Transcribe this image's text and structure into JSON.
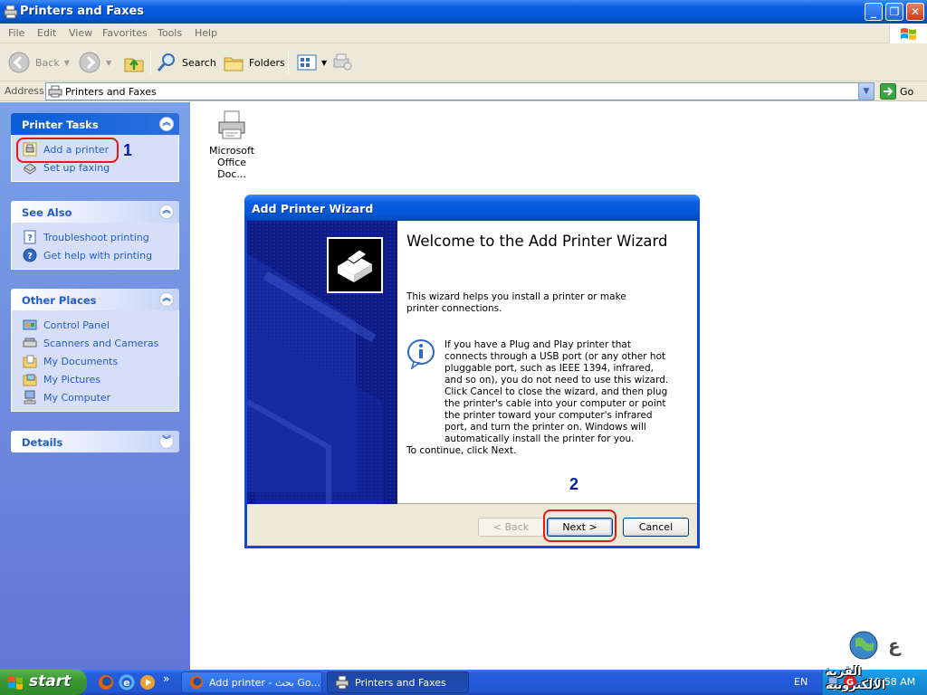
{
  "window": {
    "title": "Printers and Faxes"
  },
  "menu": [
    "File",
    "Edit",
    "View",
    "Favorites",
    "Tools",
    "Help"
  ],
  "toolbar": {
    "back": "Back",
    "search": "Search",
    "folders": "Folders"
  },
  "address": {
    "label": "Address",
    "value": "Printers and Faxes",
    "go": "Go"
  },
  "panels": {
    "printer_tasks": {
      "title": "Printer Tasks",
      "items": [
        "Add a printer",
        "Set up faxing"
      ]
    },
    "see_also": {
      "title": "See Also",
      "items": [
        "Troubleshoot printing",
        "Get help with printing"
      ]
    },
    "other_places": {
      "title": "Other Places",
      "items": [
        "Control Panel",
        "Scanners and Cameras",
        "My Documents",
        "My Pictures",
        "My Computer"
      ]
    },
    "details": {
      "title": "Details"
    }
  },
  "files": [
    {
      "label_line1": "Microsoft",
      "label_line2": "Office Doc..."
    }
  ],
  "wizard": {
    "title": "Add Printer Wizard",
    "heading": "Welcome to the Add Printer Wizard",
    "intro": "This wizard helps you install a printer or make printer connections.",
    "info": "If you have a Plug and Play printer that connects through a USB port (or any other hot pluggable port, such as IEEE 1394, infrared, and so on), you do not need to use this wizard. Click Cancel to close the wizard, and then plug the printer's cable into your computer or point the printer toward your computer's infrared port, and turn the printer on. Windows will automatically install the printer for you.",
    "continue": "To continue, click Next.",
    "buttons": {
      "back": "< Back",
      "next": "Next >",
      "cancel": "Cancel"
    }
  },
  "annotations": {
    "step1": "1",
    "step2": "2"
  },
  "taskbar": {
    "start": "start",
    "tasks": [
      "Add printer - بحث Go...",
      "Printers and Faxes"
    ],
    "language": "EN",
    "clock": "10:58 AM",
    "watermark": "القرية الالكترونية"
  },
  "colors": {
    "xp_blue": "#0a5de4",
    "taskpane": "#6375d6",
    "link": "#215dc6",
    "annotation_ring": "#e21a1a",
    "annotation_number": "#0d1ca6"
  }
}
